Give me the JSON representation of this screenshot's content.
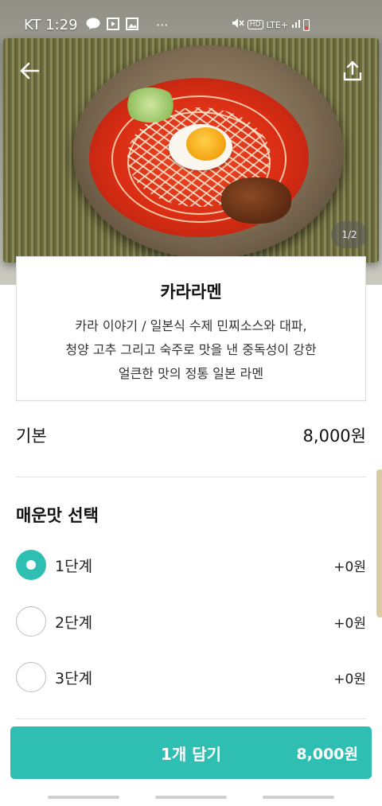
{
  "status_bar": {
    "carrier_time": "KT 1:29",
    "notif_icons": [
      "talk-icon",
      "video-icon",
      "image-icon"
    ],
    "more": "···",
    "network": "LTE+",
    "hd": "HD"
  },
  "hero": {
    "page_indicator": "1/2"
  },
  "menu": {
    "name": "카라라멘",
    "description_lines": [
      "카라 이야기 / 일본식 수제 민찌소스와 대파,",
      "청양 고추 그리고 숙주로 맛을 낸 중독성이 강한",
      "얼큰한 맛의 정통 일본 라멘"
    ]
  },
  "base": {
    "label": "기본",
    "price": "8,000원"
  },
  "spicy": {
    "title": "매운맛 선택",
    "options": [
      {
        "label": "1단계",
        "price": "+0원",
        "selected": true
      },
      {
        "label": "2단계",
        "price": "+0원",
        "selected": false
      },
      {
        "label": "3단계",
        "price": "+0원",
        "selected": false
      }
    ]
  },
  "cart": {
    "label": "1개 담기",
    "price": "8,000원"
  },
  "colors": {
    "accent": "#2ebfb2"
  }
}
